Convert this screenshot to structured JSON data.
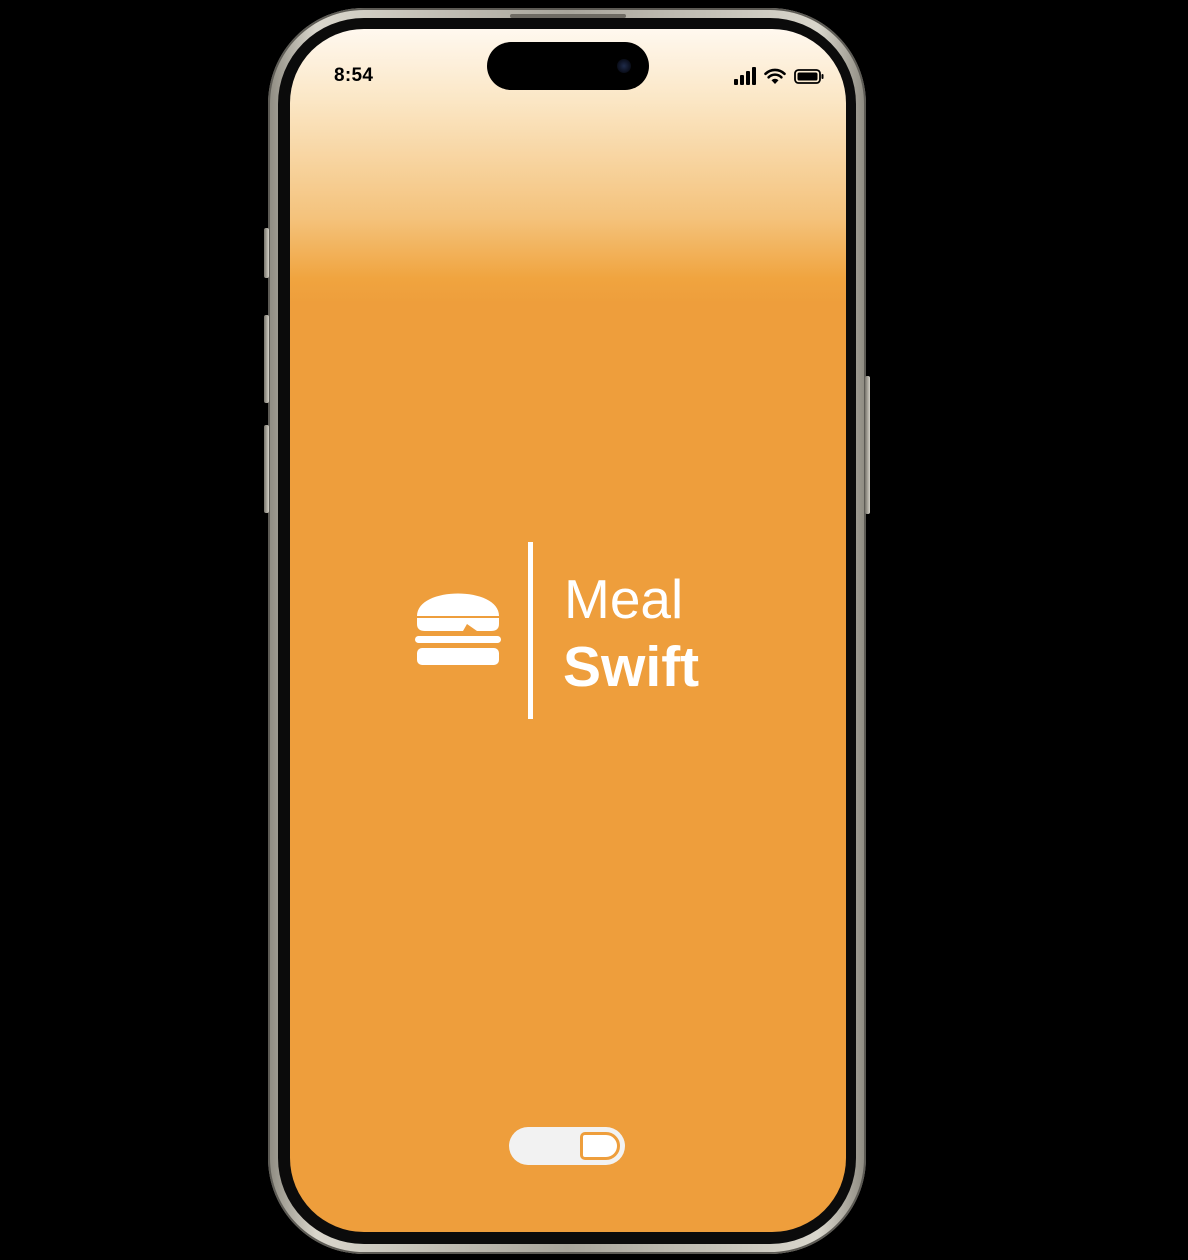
{
  "status_bar": {
    "time": "8:54",
    "signal_icon": "cellular-signal-icon",
    "wifi_icon": "wifi-icon",
    "battery_icon": "battery-icon"
  },
  "logo": {
    "icon": "burger-icon",
    "word_1": "Meal",
    "word_2": "Swift"
  },
  "toggle": {
    "state": "on"
  },
  "colors": {
    "accent": "#EE9E3C",
    "logo": "#FFFFFF"
  }
}
